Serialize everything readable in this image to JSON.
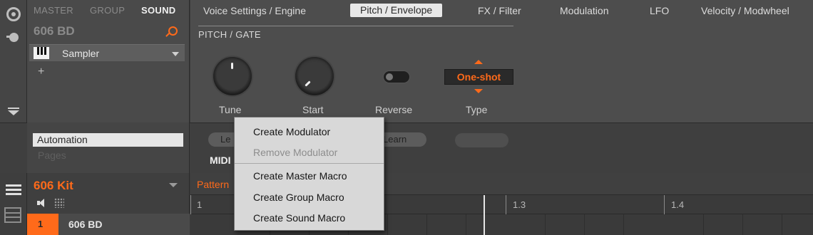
{
  "browser_tabs": [
    "MASTER",
    "GROUP",
    "SOUND"
  ],
  "sound_name": "606 BD",
  "plugin": "Sampler",
  "add_plugin": "+",
  "page_tabs": [
    "Voice Settings / Engine",
    "Pitch / Envelope",
    "FX / Filter",
    "Modulation",
    "LFO",
    "Velocity / Modwheel"
  ],
  "section_title": "PITCH / GATE",
  "params": {
    "tune_label": "Tune",
    "start_label": "Start",
    "reverse_label": "Reverse",
    "type_label": "Type",
    "type_value": "One-shot"
  },
  "automation": {
    "list_selected": "Automation",
    "list_other": "Pages",
    "learn_left": "Le",
    "learn_right": "Learn",
    "midi_label": "MIDI"
  },
  "group": {
    "name": "606 Kit",
    "sound_index": "1",
    "sound_name": "606 BD"
  },
  "pattern": {
    "label": "Pattern",
    "ruler": [
      "1",
      "1.3",
      "1.4"
    ]
  },
  "context_menu": [
    {
      "label": "Create Modulator",
      "enabled": true
    },
    {
      "label": "Remove Modulator",
      "enabled": false
    },
    {
      "label": "Create Master Macro",
      "enabled": true
    },
    {
      "label": "Create Group Macro",
      "enabled": true
    },
    {
      "label": "Create Sound Macro",
      "enabled": true
    }
  ],
  "colors": {
    "accent": "#ff6a1a",
    "menu_bg": "#d8d8d8",
    "selected_tab_bg": "#e8e8e8"
  }
}
